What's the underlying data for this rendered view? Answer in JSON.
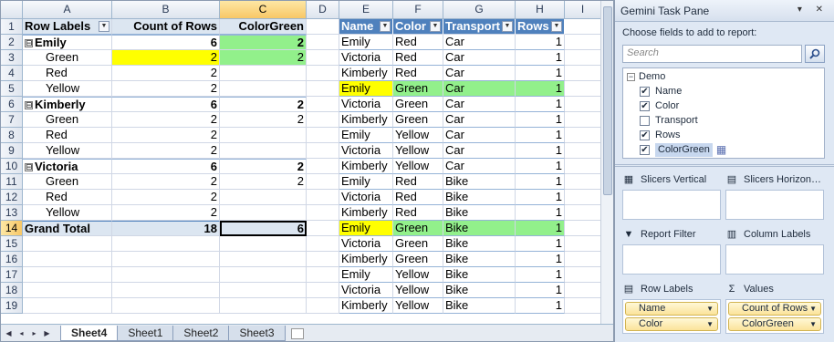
{
  "columns": [
    "",
    "A",
    "B",
    "C",
    "D",
    "E",
    "F",
    "G",
    "H",
    "I"
  ],
  "rows": [
    [
      "Row Labels",
      "Count of Rows",
      "ColorGreen",
      "",
      "Name",
      "Color",
      "Transport",
      "Rows"
    ],
    [
      "Emily",
      "6",
      "2",
      "",
      "Emily",
      "Red",
      "Car",
      "1"
    ],
    [
      "Green",
      "2",
      "2",
      "",
      "Victoria",
      "Red",
      "Car",
      "1"
    ],
    [
      "Red",
      "2",
      "",
      "",
      "Kimberly",
      "Red",
      "Car",
      "1"
    ],
    [
      "Yellow",
      "2",
      "",
      "",
      "Emily",
      "Green",
      "Car",
      "1"
    ],
    [
      "Kimberly",
      "6",
      "2",
      "",
      "Victoria",
      "Green",
      "Car",
      "1"
    ],
    [
      "Green",
      "2",
      "2",
      "",
      "Kimberly",
      "Green",
      "Car",
      "1"
    ],
    [
      "Red",
      "2",
      "",
      "",
      "Emily",
      "Yellow",
      "Car",
      "1"
    ],
    [
      "Yellow",
      "2",
      "",
      "",
      "Victoria",
      "Yellow",
      "Car",
      "1"
    ],
    [
      "Victoria",
      "6",
      "2",
      "",
      "Kimberly",
      "Yellow",
      "Car",
      "1"
    ],
    [
      "Green",
      "2",
      "2",
      "",
      "Emily",
      "Red",
      "Bike",
      "1"
    ],
    [
      "Red",
      "2",
      "",
      "",
      "Victoria",
      "Red",
      "Bike",
      "1"
    ],
    [
      "Yellow",
      "2",
      "",
      "",
      "Kimberly",
      "Red",
      "Bike",
      "1"
    ],
    [
      "Grand Total",
      "18",
      "6",
      "",
      "Emily",
      "Green",
      "Bike",
      "1"
    ],
    [
      "",
      "",
      "",
      "",
      "Victoria",
      "Green",
      "Bike",
      "1"
    ],
    [
      "",
      "",
      "",
      "",
      "Kimberly",
      "Green",
      "Bike",
      "1"
    ],
    [
      "",
      "",
      "",
      "",
      "Emily",
      "Yellow",
      "Bike",
      "1"
    ],
    [
      "",
      "",
      "",
      "",
      "Victoria",
      "Yellow",
      "Bike",
      "1"
    ],
    [
      "",
      "",
      "",
      "",
      "Kimberly",
      "Yellow",
      "Bike",
      "1"
    ]
  ],
  "row_numbers": [
    "1",
    "2",
    "3",
    "4",
    "5",
    "6",
    "7",
    "8",
    "9",
    "10",
    "11",
    "12",
    "13",
    "14",
    "15",
    "16",
    "17",
    "18",
    "19"
  ],
  "toggle_symbol": "⊟",
  "sheet_tabs": [
    "Sheet4",
    "Sheet1",
    "Sheet2",
    "Sheet3"
  ],
  "active_sheet": "Sheet4",
  "pane": {
    "title": "Gemini Task Pane",
    "controls": "▾ ✕",
    "choose_label": "Choose fields to add to report:",
    "search_placeholder": "Search",
    "table_name": "Demo",
    "fields": [
      {
        "label": "Name",
        "checked": true
      },
      {
        "label": "Color",
        "checked": true
      },
      {
        "label": "Transport",
        "checked": false
      },
      {
        "label": "Rows",
        "checked": true
      },
      {
        "label": "ColorGreen",
        "checked": true
      }
    ],
    "slicers_vertical": "Slicers Vertical",
    "slicers_horizontal": "Slicers Horizon…",
    "report_filter": "Report Filter",
    "column_labels": "Column Labels",
    "row_labels": "Row Labels",
    "values": "Values",
    "row_label_items": [
      "Name",
      "Color"
    ],
    "value_items": [
      "Count of Rows",
      "ColorGreen"
    ]
  },
  "colors": {
    "header_blue": "#4f81bd",
    "pivot_header": "#dce6f1",
    "highlight_yellow": "#ffff00",
    "highlight_green": "#92f08b"
  }
}
